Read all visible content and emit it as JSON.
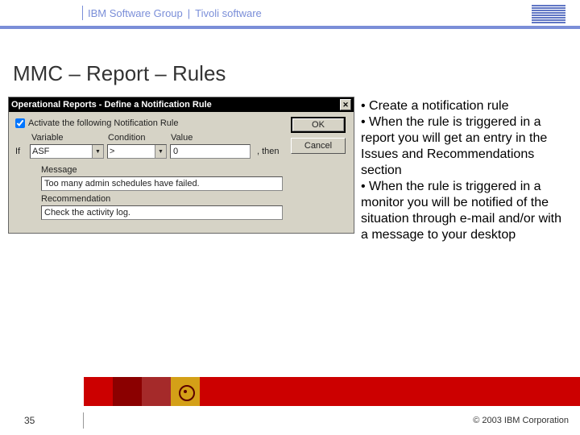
{
  "header": {
    "group": "IBM Software Group",
    "separator": "|",
    "product": "Tivoli software",
    "logo_alt": "IBM"
  },
  "title": "MMC – Report – Rules",
  "dialog": {
    "titlebar": "Operational Reports - Define a Notification Rule",
    "close": "✕",
    "activate_label": "Activate the following Notification Rule",
    "activate_checked": true,
    "columns": {
      "variable": "Variable",
      "condition": "Condition",
      "value": "Value"
    },
    "row": {
      "if": "If",
      "variable": "ASF",
      "condition": ">",
      "value": "0",
      "then": ", then"
    },
    "message_label": "Message",
    "message_value": "Too many admin schedules have failed.",
    "recommendation_label": "Recommendation",
    "recommendation_value": "Check the activity log.",
    "ok": "OK",
    "cancel": "Cancel"
  },
  "bullets": {
    "b1": "• Create a notification rule",
    "b2": "• When the rule is triggered in a report you will get an entry in the Issues and Recommendations section",
    "b3": "• When the rule is triggered in a monitor you will be notified of the situation through e-mail and/or with a message to your desktop"
  },
  "footer": {
    "page": "35",
    "copyright": "© 2003 IBM Corporation"
  }
}
